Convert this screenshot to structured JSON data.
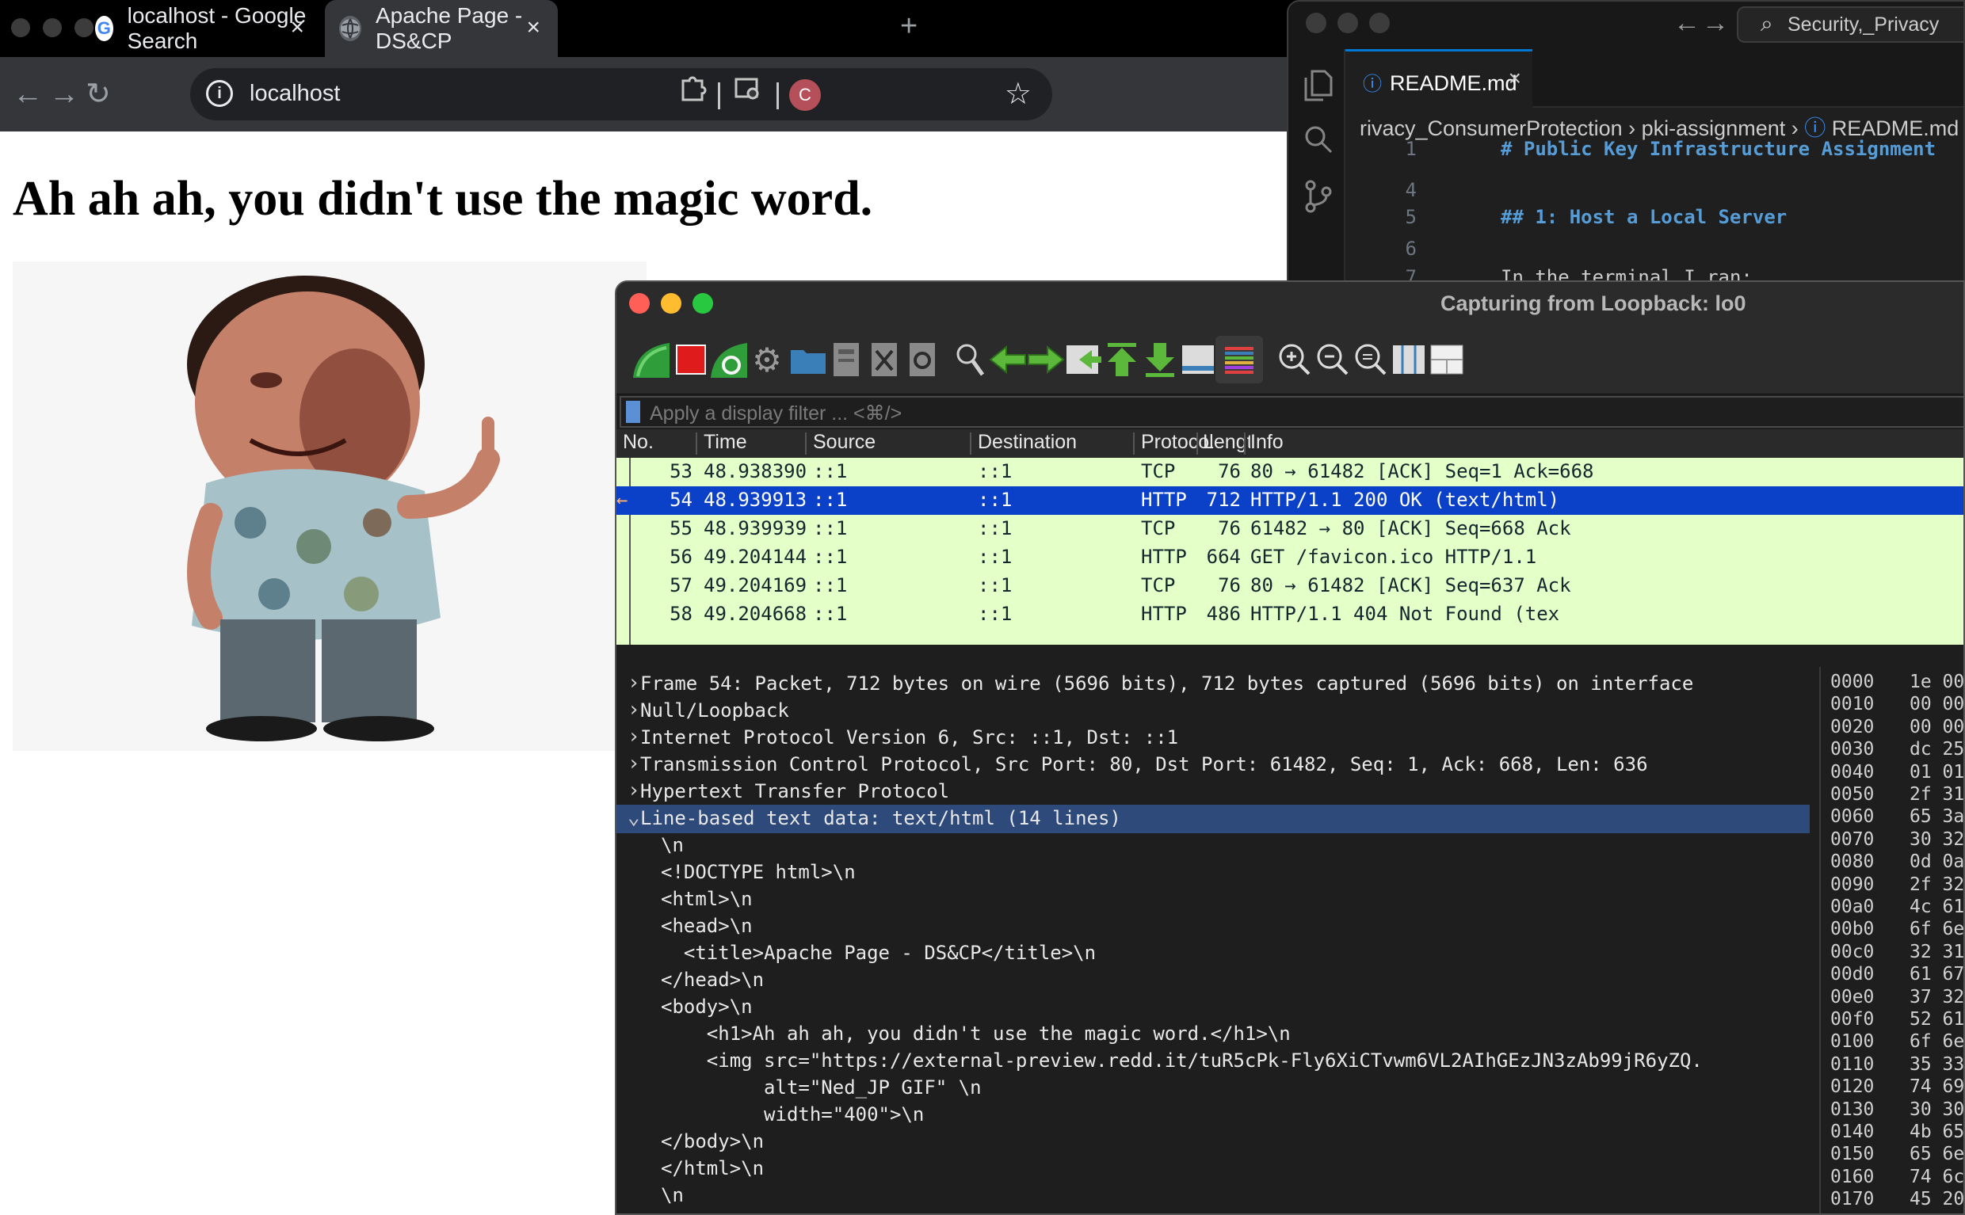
{
  "browser": {
    "tabs": [
      {
        "title": "localhost - Google Search",
        "favicon": "google-icon",
        "active": false
      },
      {
        "title": "Apache Page - DS&CP",
        "favicon": "globe-icon",
        "active": true
      }
    ],
    "url": "localhost",
    "avatar_letter": "C",
    "page": {
      "heading": "Ah ah ah, you didn't use the magic word."
    }
  },
  "vscode": {
    "search_text": "Security,_Privacy",
    "tab_label": "README.md",
    "breadcrumb": {
      "part1": "rivacy_ConsumerProtection",
      "part2": "pki-assignment",
      "part3": "README.md"
    },
    "lines": [
      {
        "num": "1",
        "text": "# Public Key Infrastructure Assignment"
      },
      {
        "num": "4",
        "text": ""
      },
      {
        "num": "5",
        "text": "## 1: Host a Local Server"
      },
      {
        "num": "6",
        "text": ""
      },
      {
        "num": "7",
        "text": "In the terminal I ran:"
      }
    ]
  },
  "wireshark": {
    "title": "Capturing from Loopback: lo0",
    "filter_placeholder": "Apply a display filter ... <⌘/>",
    "columns": {
      "no": "No.",
      "time": "Time",
      "source": "Source",
      "destination": "Destination",
      "protocol": "Protocol",
      "length": "Length",
      "info": "Info"
    },
    "packets": [
      {
        "no": "53",
        "time": "48.938390",
        "src": "::1",
        "dst": "::1",
        "proto": "TCP",
        "len": "76",
        "info": "80 → 61482 [ACK] Seq=1 Ack=668"
      },
      {
        "no": "54",
        "time": "48.939913",
        "src": "::1",
        "dst": "::1",
        "proto": "HTTP",
        "len": "712",
        "info": "HTTP/1.1 200 OK  (text/html)"
      },
      {
        "no": "55",
        "time": "48.939939",
        "src": "::1",
        "dst": "::1",
        "proto": "TCP",
        "len": "76",
        "info": "61482 → 80 [ACK] Seq=668 Ack"
      },
      {
        "no": "56",
        "time": "49.204144",
        "src": "::1",
        "dst": "::1",
        "proto": "HTTP",
        "len": "664",
        "info": "GET /favicon.ico HTTP/1.1"
      },
      {
        "no": "57",
        "time": "49.204169",
        "src": "::1",
        "dst": "::1",
        "proto": "TCP",
        "len": "76",
        "info": "80 → 61482 [ACK] Seq=637 Ack"
      },
      {
        "no": "58",
        "time": "49.204668",
        "src": "::1",
        "dst": "::1",
        "proto": "HTTP",
        "len": "486",
        "info": "HTTP/1.1 404 Not Found  (tex"
      }
    ],
    "details": [
      {
        "arrow": "›",
        "indent": 0,
        "text": "Frame 54: Packet, 712 bytes on wire (5696 bits), 712 bytes captured (5696 bits) on interface"
      },
      {
        "arrow": "›",
        "indent": 0,
        "text": "Null/Loopback"
      },
      {
        "arrow": "›",
        "indent": 0,
        "text": "Internet Protocol Version 6, Src: ::1, Dst: ::1"
      },
      {
        "arrow": "›",
        "indent": 0,
        "text": "Transmission Control Protocol, Src Port: 80, Dst Port: 61482, Seq: 1, Ack: 668, Len: 636"
      },
      {
        "arrow": "›",
        "indent": 0,
        "text": "Hypertext Transfer Protocol"
      },
      {
        "arrow": "⌄",
        "indent": 0,
        "text": "Line-based text data: text/html (14 lines)"
      },
      {
        "arrow": "",
        "indent": 1,
        "text": "\\n"
      },
      {
        "arrow": "",
        "indent": 1,
        "text": "<!DOCTYPE html>\\n"
      },
      {
        "arrow": "",
        "indent": 1,
        "text": "<html>\\n"
      },
      {
        "arrow": "",
        "indent": 1,
        "text": "<head>\\n"
      },
      {
        "arrow": "",
        "indent": 1,
        "text": "  <title>Apache Page - DS&CP</title>\\n"
      },
      {
        "arrow": "",
        "indent": 1,
        "text": "</head>\\n"
      },
      {
        "arrow": "",
        "indent": 1,
        "text": "<body>\\n"
      },
      {
        "arrow": "",
        "indent": 1,
        "text": "    <h1>Ah ah ah, you didn't use the magic word.</h1>\\n"
      },
      {
        "arrow": "",
        "indent": 1,
        "text": "    <img src=\"https://external-preview.redd.it/tuR5cPk-Fly6XiCTvwm6VL2AIhGEzJN3zAb99jR6yZQ."
      },
      {
        "arrow": "",
        "indent": 1,
        "text": "         alt=\"Ned_JP GIF\" \\n"
      },
      {
        "arrow": "",
        "indent": 1,
        "text": "         width=\"400\">\\n"
      },
      {
        "arrow": "",
        "indent": 1,
        "text": "</body>\\n"
      },
      {
        "arrow": "",
        "indent": 1,
        "text": "</html>\\n"
      },
      {
        "arrow": "",
        "indent": 1,
        "text": "\\n"
      }
    ],
    "bytes": [
      {
        "offset": "0000",
        "hex": "1e 00"
      },
      {
        "offset": "0010",
        "hex": "00 00"
      },
      {
        "offset": "0020",
        "hex": "00 00"
      },
      {
        "offset": "0030",
        "hex": "dc 25"
      },
      {
        "offset": "0040",
        "hex": "01 01"
      },
      {
        "offset": "0050",
        "hex": "2f 31"
      },
      {
        "offset": "0060",
        "hex": "65 3a"
      },
      {
        "offset": "0070",
        "hex": "30 32"
      },
      {
        "offset": "0080",
        "hex": "0d 0a"
      },
      {
        "offset": "0090",
        "hex": "2f 32"
      },
      {
        "offset": "00a0",
        "hex": "4c 61"
      },
      {
        "offset": "00b0",
        "hex": "6f 6e"
      },
      {
        "offset": "00c0",
        "hex": "32 31"
      },
      {
        "offset": "00d0",
        "hex": "61 67"
      },
      {
        "offset": "00e0",
        "hex": "37 32"
      },
      {
        "offset": "00f0",
        "hex": "52 61"
      },
      {
        "offset": "0100",
        "hex": "6f 6e"
      },
      {
        "offset": "0110",
        "hex": "35 33"
      },
      {
        "offset": "0120",
        "hex": "74 69"
      },
      {
        "offset": "0130",
        "hex": "30 30"
      },
      {
        "offset": "0140",
        "hex": "4b 65"
      },
      {
        "offset": "0150",
        "hex": "65 6e"
      },
      {
        "offset": "0160",
        "hex": "74 6c"
      },
      {
        "offset": "0170",
        "hex": "45 20"
      }
    ]
  }
}
